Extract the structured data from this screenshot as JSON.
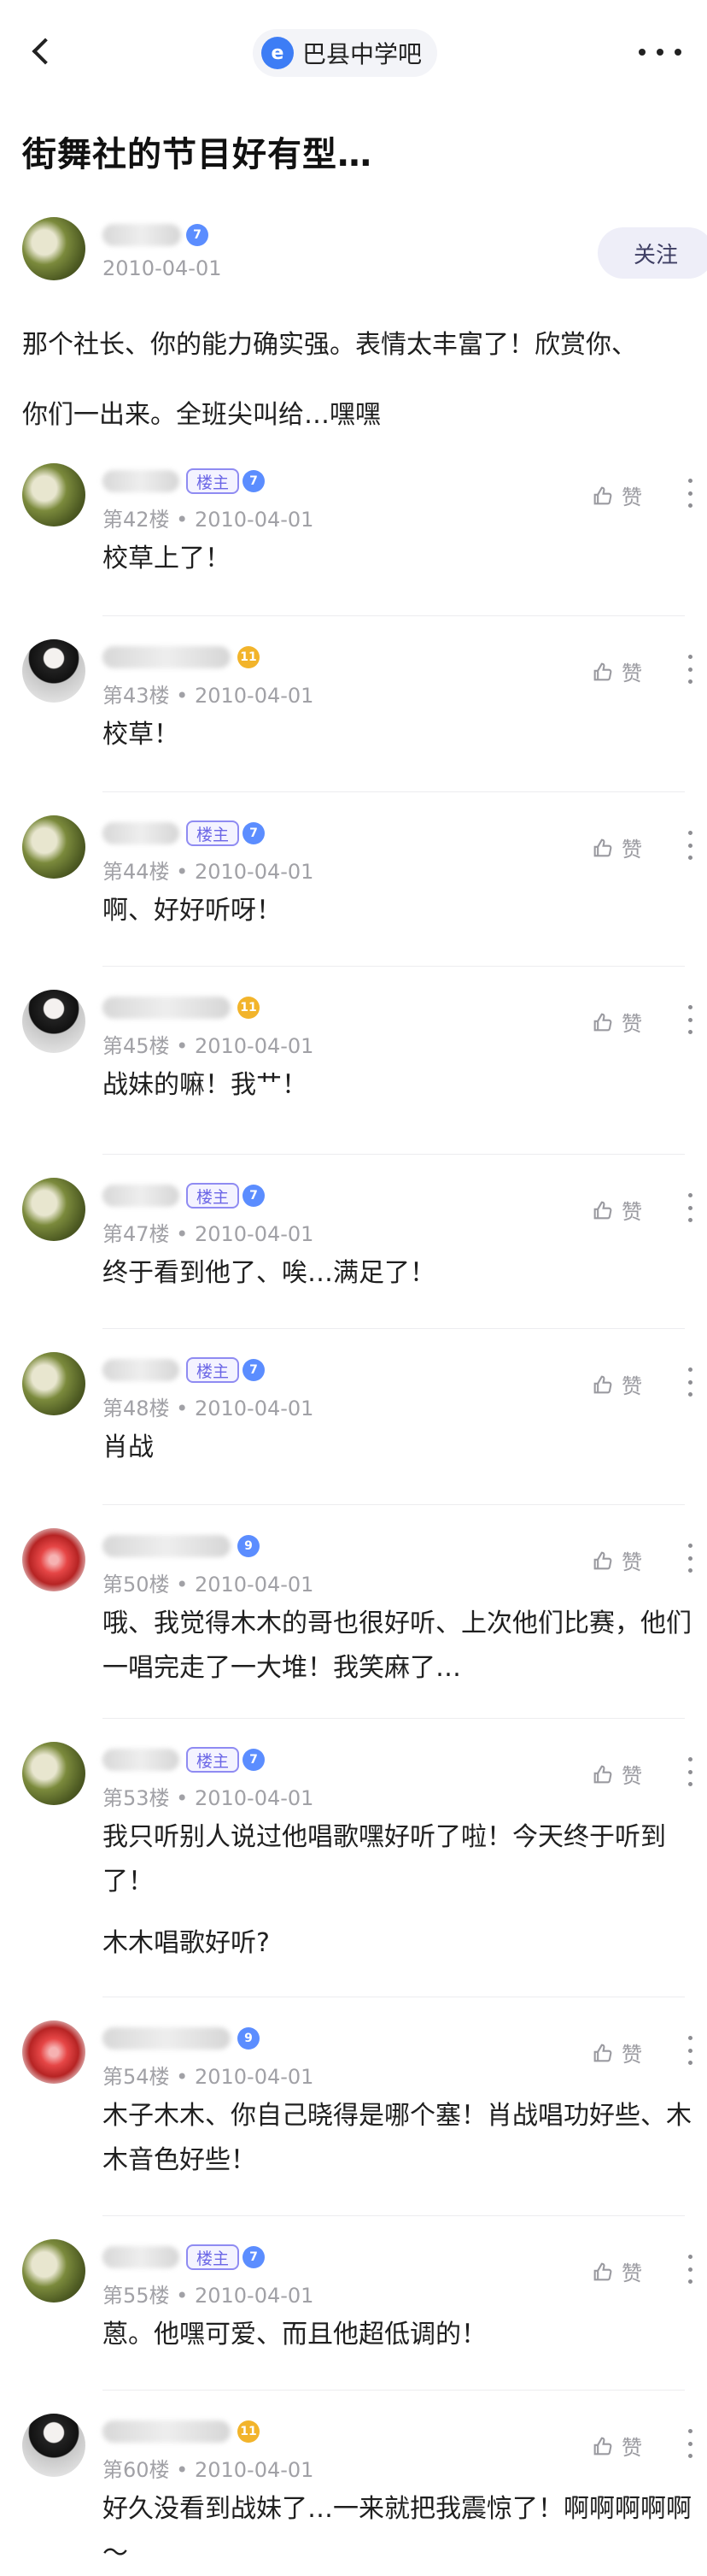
{
  "nav": {
    "forum_name": "巴县中学吧",
    "forum_logo_text": "e"
  },
  "post": {
    "title": "街舞社的节目好有型…",
    "op": {
      "level": "7",
      "date": "2010-04-01",
      "follow_label": "关注",
      "body_line1": "那个社长、你的能力确实强。表情太丰富了！欣赏你、",
      "body_line2": "你们一出来。全班尖叫给…嘿嘿"
    }
  },
  "labels": {
    "host": "楼主",
    "like": "赞"
  },
  "replies": [
    {
      "floor": "第42楼 • 2010-04-01",
      "level": "7",
      "host": true,
      "text": "校草上了！"
    },
    {
      "floor": "第43楼 • 2010-04-01",
      "level": "11",
      "host": false,
      "text": "校草！"
    },
    {
      "floor": "第44楼 • 2010-04-01",
      "level": "7",
      "host": true,
      "text": "啊、好好听呀！"
    },
    {
      "floor": "第45楼 • 2010-04-01",
      "level": "11",
      "host": false,
      "text": "战妹的嘛！我艹！"
    },
    {
      "floor": "第47楼 • 2010-04-01",
      "level": "7",
      "host": true,
      "text": "终于看到他了、唉…满足了！"
    },
    {
      "floor": "第48楼 • 2010-04-01",
      "level": "7",
      "host": true,
      "text": "肖战"
    },
    {
      "floor": "第50楼 • 2010-04-01",
      "level": "9",
      "host": false,
      "text": "哦、我觉得木木的哥也很好听、上次他们比赛，他们一唱完走了一大堆！我笑麻了…"
    },
    {
      "floor": "第53楼 • 2010-04-01",
      "level": "7",
      "host": true,
      "text": "我只听别人说过他唱歌嘿好听了啦！今天终于听到了！",
      "text2": "木木唱歌好听?"
    },
    {
      "floor": "第54楼 • 2010-04-01",
      "level": "9",
      "host": false,
      "text": "木子木木、你自己晓得是哪个塞！肖战唱功好些、木木音色好些！"
    },
    {
      "floor": "第55楼 • 2010-04-01",
      "level": "7",
      "host": true,
      "text": "蒽。他嘿可爱、而且他超低调的！"
    },
    {
      "floor": "第60楼 • 2010-04-01",
      "level": "11",
      "host": false,
      "text": "好久没看到战妹了…一来就把我震惊了！啊啊啊啊啊～"
    }
  ]
}
